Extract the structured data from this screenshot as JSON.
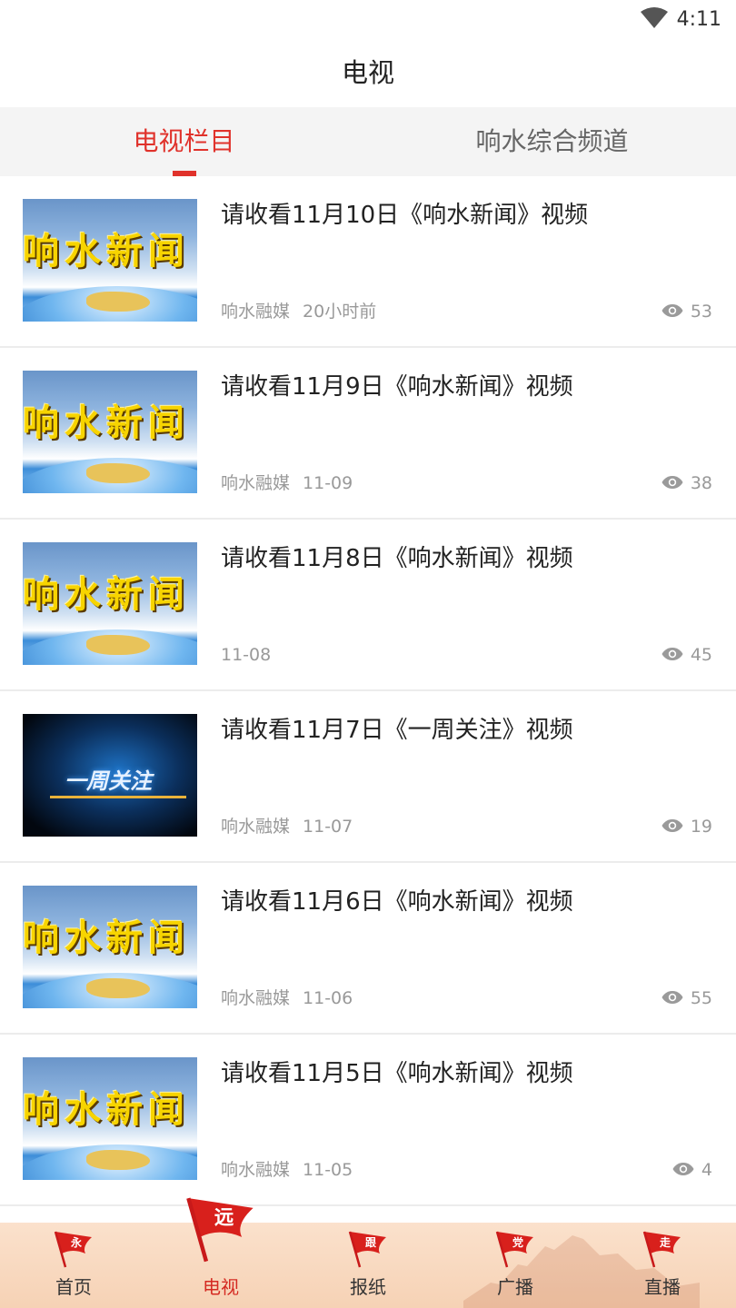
{
  "status_bar": {
    "time": "4:11",
    "wifi_icon": "wifi-icon"
  },
  "header": {
    "title": "电视"
  },
  "tabs": [
    {
      "label": "电视栏目",
      "active": true
    },
    {
      "label": "响水综合频道",
      "active": false
    }
  ],
  "colors": {
    "accent": "#e0322b",
    "nav_bg": "#f8dac3",
    "meta": "#999999"
  },
  "list": [
    {
      "title": "请收看11月10日《响水新闻》视频",
      "source": "响水融媒",
      "time": "20小时前",
      "views": "53",
      "thumb_text": "响水新闻"
    },
    {
      "title": "请收看11月9日《响水新闻》视频",
      "source": "响水融媒",
      "time": "11-09",
      "views": "38",
      "thumb_text": "响水新闻"
    },
    {
      "title": "请收看11月8日《响水新闻》视频",
      "source": "",
      "time": "11-08",
      "views": "45",
      "thumb_text": "响水新闻"
    },
    {
      "title": "请收看11月7日《一周关注》视频",
      "source": "响水融媒",
      "time": "11-07",
      "views": "19",
      "thumb_text": "一周关注"
    },
    {
      "title": "请收看11月6日《响水新闻》视频",
      "source": "响水融媒",
      "time": "11-06",
      "views": "55",
      "thumb_text": "响水新闻"
    },
    {
      "title": "请收看11月5日《响水新闻》视频",
      "source": "响水融媒",
      "time": "11-05",
      "views": "4",
      "thumb_text": "响水新闻"
    }
  ],
  "bottom_nav": [
    {
      "label": "首页",
      "flag_char": "永",
      "active": false
    },
    {
      "label": "电视",
      "flag_char": "远",
      "active": true
    },
    {
      "label": "报纸",
      "flag_char": "跟",
      "active": false
    },
    {
      "label": "广播",
      "flag_char": "党",
      "active": false
    },
    {
      "label": "直播",
      "flag_char": "走",
      "active": false
    }
  ]
}
